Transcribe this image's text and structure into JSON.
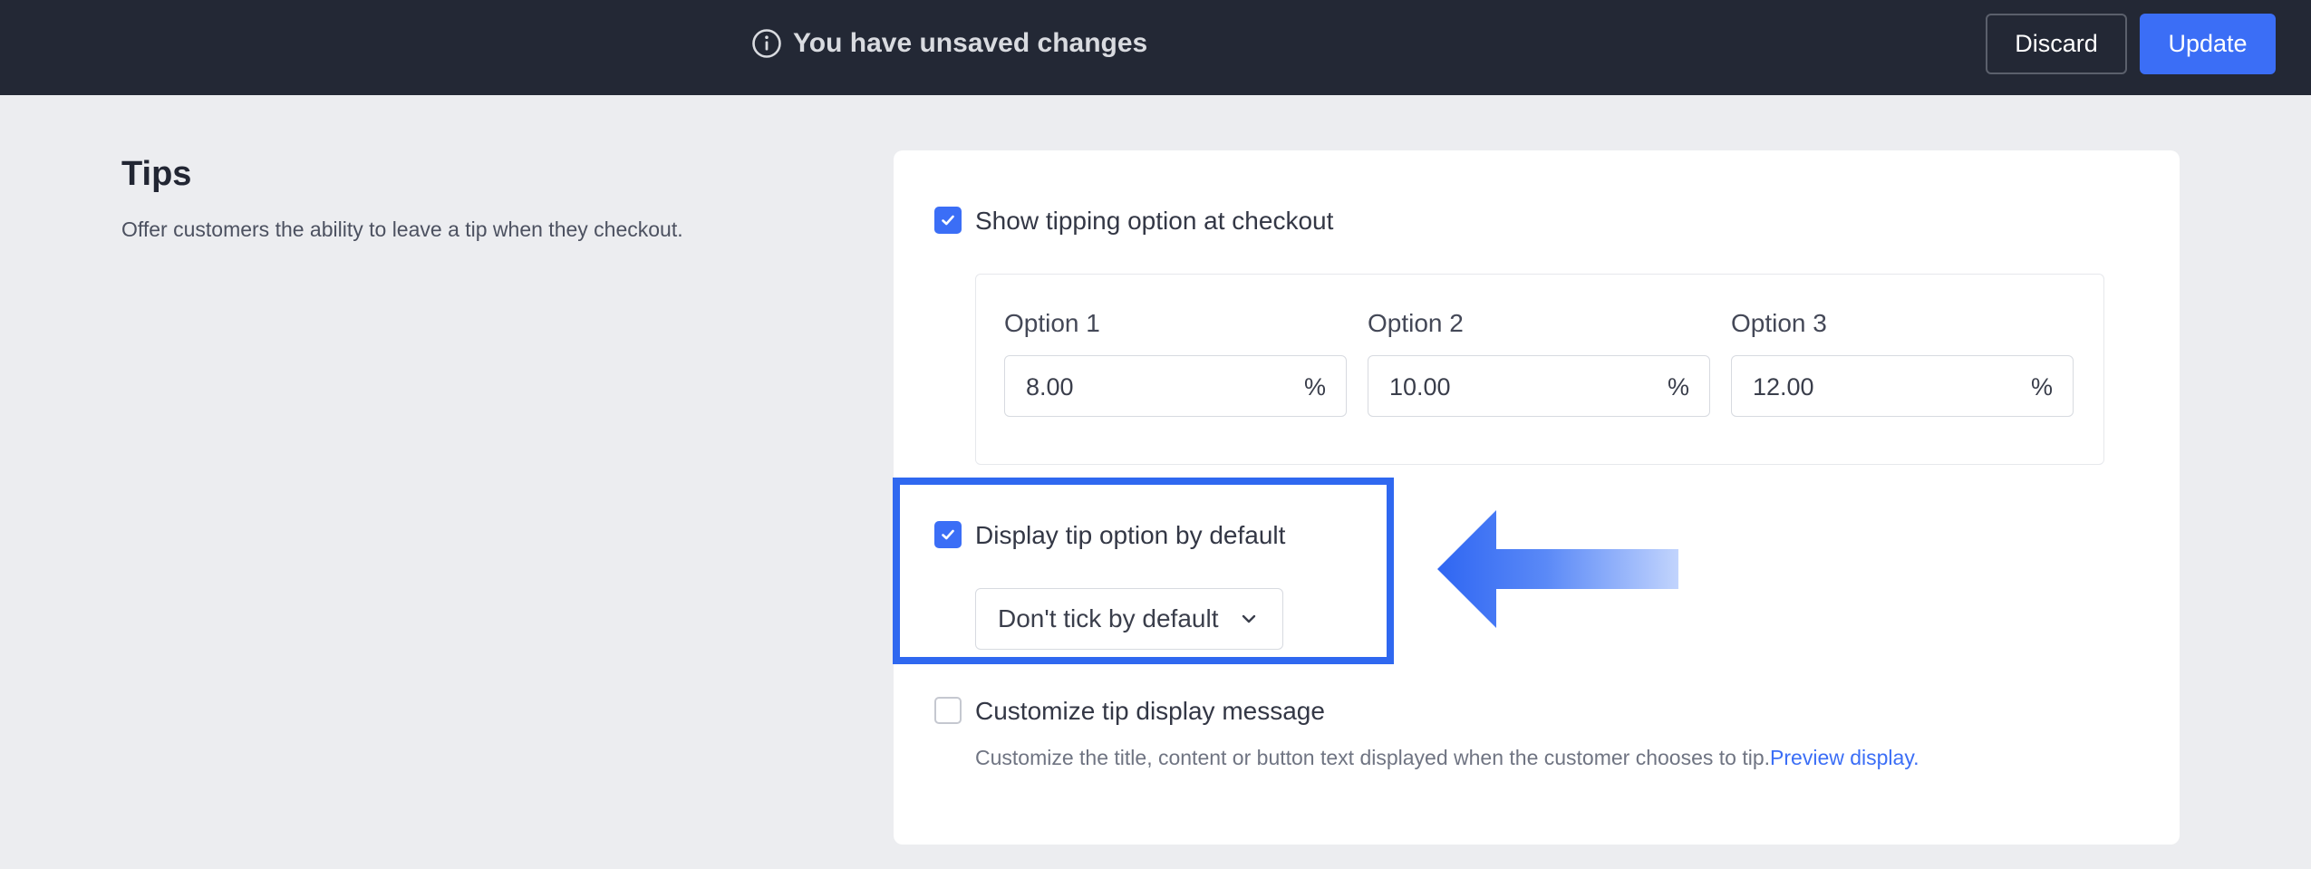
{
  "topbar": {
    "unsaved_text": "You have unsaved changes",
    "discard_label": "Discard",
    "update_label": "Update"
  },
  "section": {
    "title": "Tips",
    "description": "Offer customers the ability to leave a tip when they checkout."
  },
  "show_tipping": {
    "label": "Show tipping option at checkout",
    "checked": true
  },
  "options": [
    {
      "label": "Option 1",
      "value": "8.00",
      "unit": "%"
    },
    {
      "label": "Option 2",
      "value": "10.00",
      "unit": "%"
    },
    {
      "label": "Option 3",
      "value": "12.00",
      "unit": "%"
    }
  ],
  "display_default": {
    "label": "Display tip option by default",
    "checked": true,
    "select_value": "Don't tick by default"
  },
  "customize": {
    "label": "Customize tip display message",
    "checked": false,
    "help_text": "Customize the title, content or button text displayed when the customer chooses to tip.",
    "link_text": "Preview display."
  },
  "colors": {
    "accent": "#3b6ef6",
    "topbar_bg": "#232835",
    "page_bg": "#ecedf0",
    "highlight_border": "#2f68f0"
  }
}
